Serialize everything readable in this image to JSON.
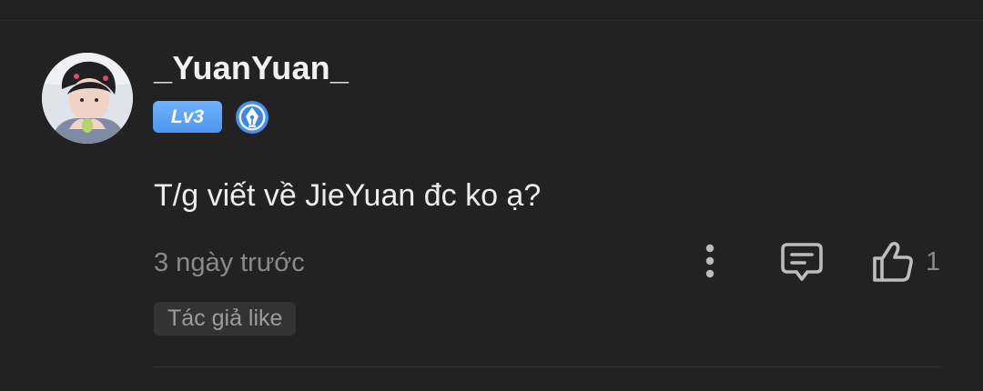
{
  "comment": {
    "username": "_YuanYuan_",
    "level_badge": "Lv3",
    "author_badge_icon": "pen-nib-icon",
    "text": "T/g viết về JieYuan đc ko ạ?",
    "timestamp": "3 ngày trước",
    "like_count": "1",
    "tag": "Tác giả like",
    "actions": {
      "more_icon": "more-vertical-icon",
      "reply_icon": "comment-icon",
      "like_icon": "thumbs-up-icon"
    }
  },
  "colors": {
    "background": "#222222",
    "level_badge": "#5aa0f5",
    "muted_text": "#8a8a8a",
    "chip_background": "#333333"
  }
}
